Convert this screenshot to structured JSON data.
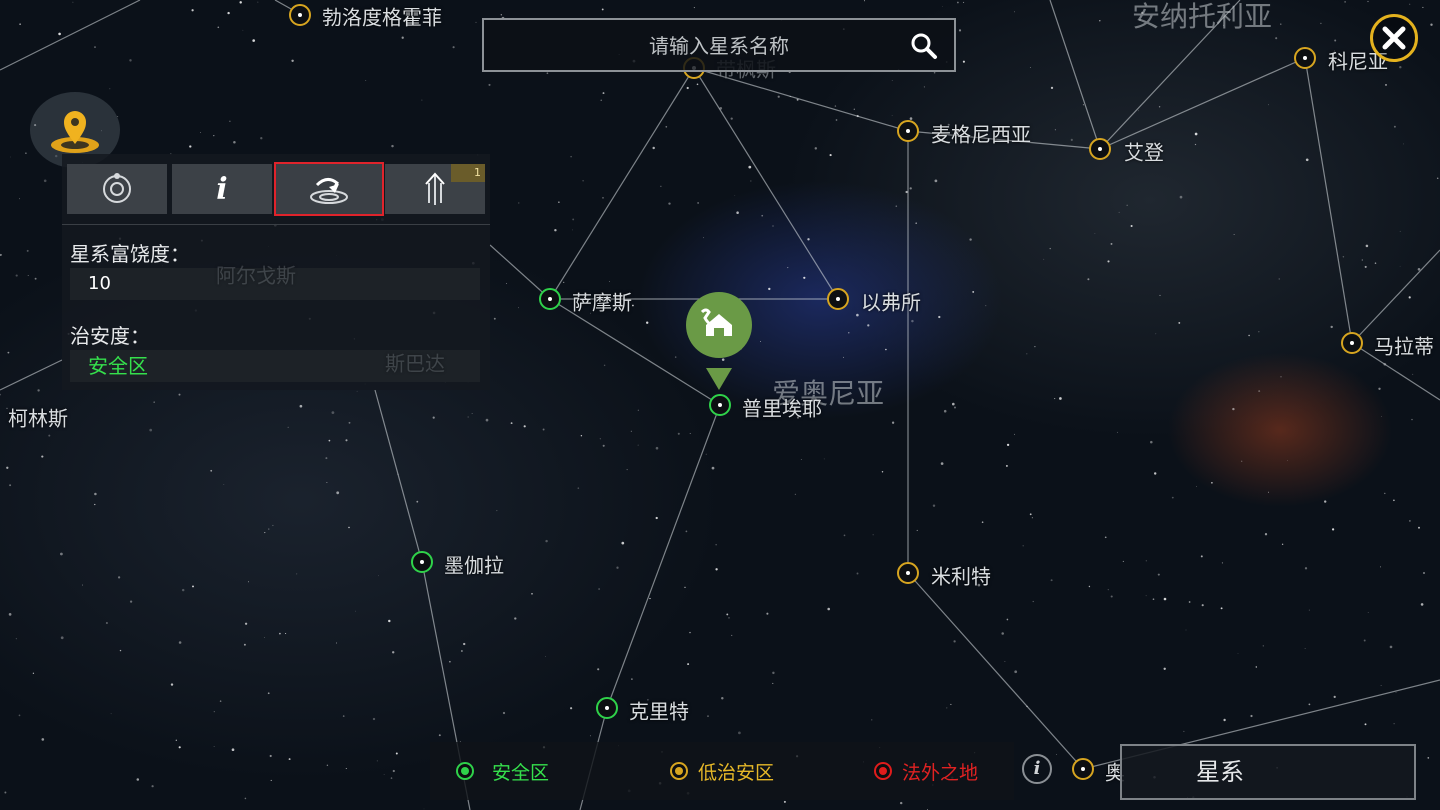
{
  "search": {
    "placeholder": "请输入星系名称",
    "icon": "search-icon"
  },
  "close": {
    "icon": "close-icon"
  },
  "regions": [
    {
      "key": "anatolia",
      "name": "安纳托利亚"
    },
    {
      "key": "ionia",
      "name": "爱奥尼亚"
    }
  ],
  "systems": [
    {
      "key": "bolodugehuofei",
      "name": "勃洛度格霍菲",
      "security": "low"
    },
    {
      "key": "daiqusi",
      "name": "带枫斯",
      "security": "low"
    },
    {
      "key": "maigenixiya",
      "name": "麦格尼西亚",
      "security": "low"
    },
    {
      "key": "aideng",
      "name": "艾登",
      "security": "low"
    },
    {
      "key": "keniya",
      "name": "科尼亚",
      "security": "low"
    },
    {
      "key": "samosi",
      "name": "萨摩斯",
      "security": "safe"
    },
    {
      "key": "yifusuo",
      "name": "以弗所",
      "security": "low"
    },
    {
      "key": "malati",
      "name": "马拉蒂",
      "security": "low"
    },
    {
      "key": "pulieyuan",
      "name": "普里埃耶",
      "security": "safe"
    },
    {
      "key": "kelinsi",
      "name": "柯林斯",
      "security": "safe"
    },
    {
      "key": "mojiala",
      "name": "墨伽拉",
      "security": "safe"
    },
    {
      "key": "milite",
      "name": "米利特",
      "security": "low"
    },
    {
      "key": "kelite",
      "name": "克里特",
      "security": "safe"
    },
    {
      "key": "ao",
      "name": "奥",
      "security": "low"
    },
    {
      "key": "aergesi",
      "name": "阿尔戈斯",
      "security": "safe"
    },
    {
      "key": "sibada",
      "name": "斯巴达",
      "security": "safe"
    }
  ],
  "panel": {
    "tabs": [
      {
        "icon": "orbit-icon"
      },
      {
        "icon": "info-icon"
      },
      {
        "icon": "warp-icon",
        "active": true
      },
      {
        "icon": "jump-icon",
        "badge": "1"
      }
    ],
    "richness_label": "星系富饶度：",
    "richness_value": "10",
    "security_label": "治安度：",
    "security_value": "安全区"
  },
  "legend": {
    "safe": "安全区",
    "low": "低治安区",
    "lawless": "法外之地"
  },
  "galaxy_button": "星系",
  "colors": {
    "safe": "#2fd24a",
    "low": "#d7a520",
    "lawless": "#e01c1c",
    "highlight": "#e0232b"
  }
}
